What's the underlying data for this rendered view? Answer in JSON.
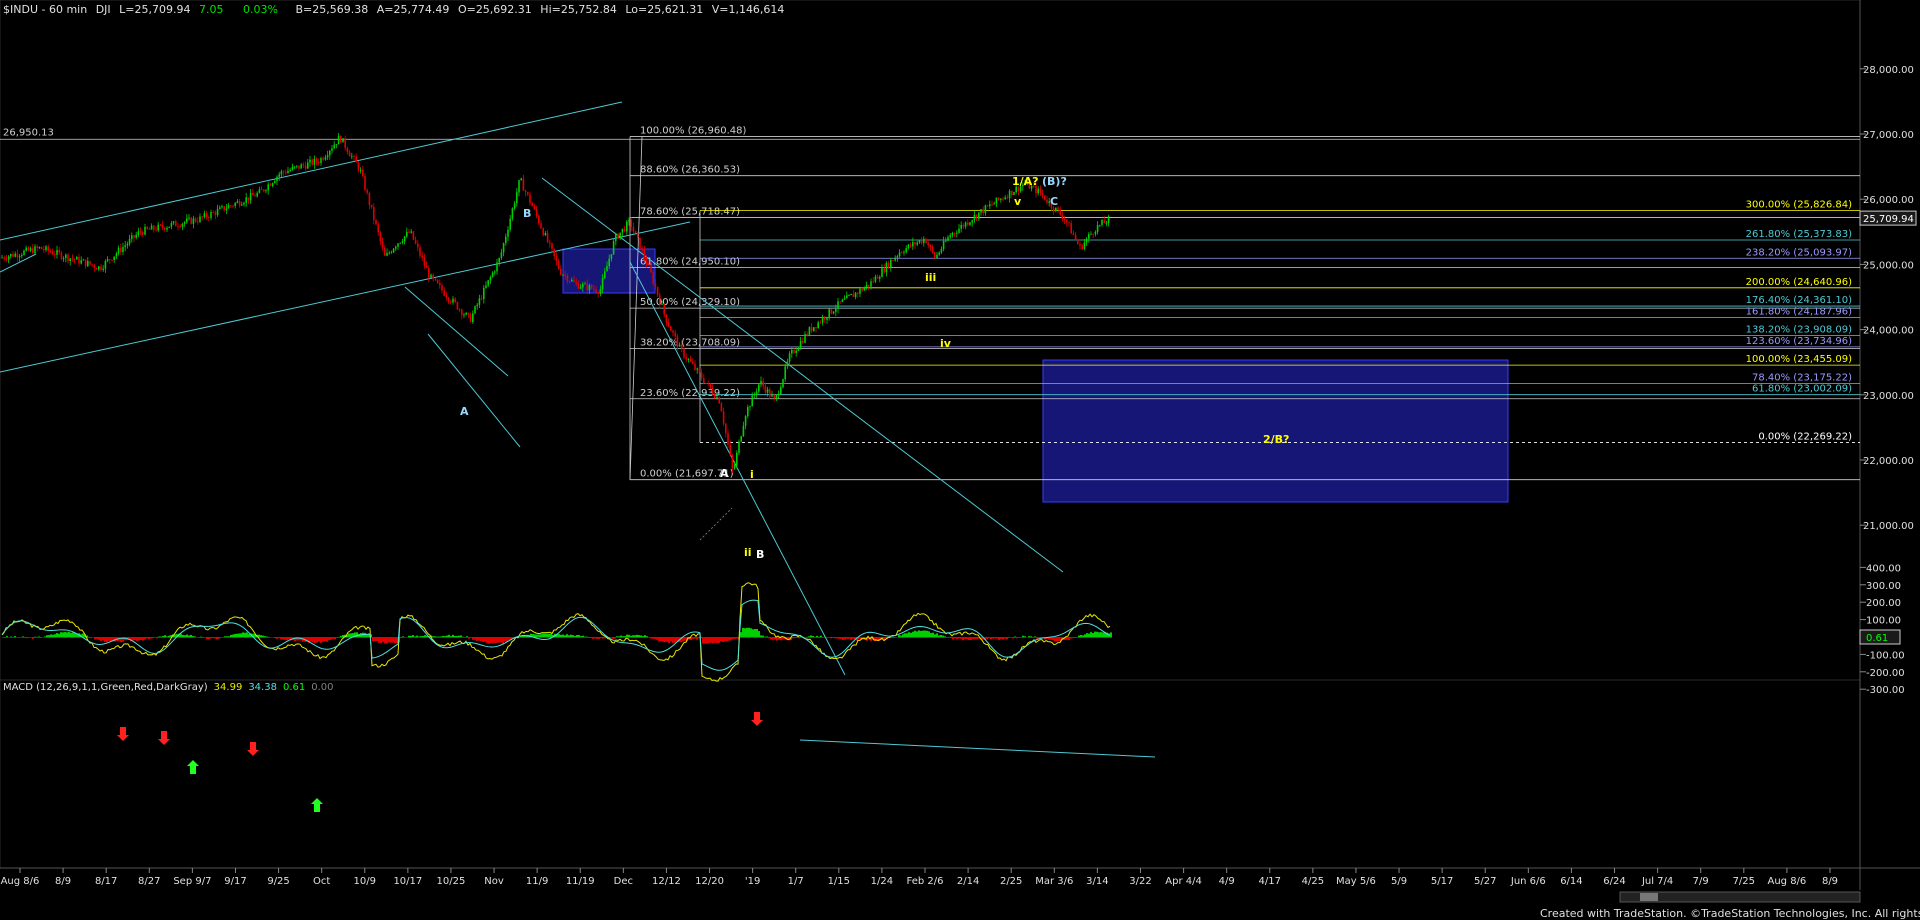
{
  "header": {
    "symbol": "$INDU - 60 min",
    "exchange": "DJI",
    "last": "L=25,709.94",
    "change": "7.05",
    "pct": "0.03%",
    "bid": "B=25,569.38",
    "ask": "A=25,774.49",
    "open": "O=25,692.31",
    "high": "Hi=25,752.84",
    "low": "Lo=25,621.31",
    "volume": "V=1,146,614"
  },
  "price_axis": {
    "ticks": [
      "28,000.00",
      "27,000.00",
      "26,000.00",
      "25,000.00",
      "24,000.00",
      "23,000.00",
      "22,000.00",
      "21,000.00"
    ],
    "ymin": 20500,
    "ymax": 28600,
    "last_price_label": "25,709.94"
  },
  "macd": {
    "title": "MACD (12,26,9,1,1,Green,Red,DarkGray)",
    "values": [
      "34.99",
      "34.38",
      "0.61",
      "0.00"
    ],
    "value_colors": [
      "#e8e800",
      "#4ee0e0",
      "#00ff00",
      "#808080"
    ],
    "ticks": [
      "400.00",
      "300.00",
      "200.00",
      "100.00",
      "-100.00",
      "-200.00",
      "-300.00"
    ],
    "last_label": "0.61",
    "ymin": -380,
    "ymax": 430
  },
  "x_axis": {
    "labels": [
      "Aug 8/6",
      "8/9",
      "8/17",
      "8/27",
      "Sep 9/7",
      "9/17",
      "9/25",
      "Oct",
      "10/9",
      "10/17",
      "10/25",
      "Nov",
      "11/9",
      "11/19",
      "Dec",
      "12/12",
      "12/20",
      "'19",
      "1/7",
      "1/15",
      "1/24",
      "Feb 2/6",
      "2/14",
      "2/25",
      "Mar 3/6",
      "3/14",
      "3/22",
      "Apr 4/4",
      "4/9",
      "4/17",
      "4/25",
      "May 5/6",
      "5/9",
      "5/17",
      "5/27",
      "Jun 6/6",
      "6/14",
      "6/24",
      "Jul 7/4",
      "7/9",
      "7/25",
      "Aug 8/6",
      "8/9"
    ]
  },
  "fib_left": [
    {
      "label": "100.00% (26,960.48)",
      "price": 26960.48
    },
    {
      "label": "88.60% (26,360.53)",
      "price": 26360.53
    },
    {
      "label": "78.60% (25,718.47)",
      "price": 25718.47
    },
    {
      "label": "61.80% (24,950.10)",
      "price": 24950.1
    },
    {
      "label": "50.00% (24,329.10)",
      "price": 24329.1
    },
    {
      "label": "38.20% (23,708.09)",
      "price": 23708.09
    },
    {
      "label": "23.60% (22,939.22)",
      "price": 22939.22
    },
    {
      "label": "0.00% (21,697.71)",
      "price": 21697.71
    }
  ],
  "fib_right": [
    {
      "label": "300.00% (25,826.84)",
      "price": 25826.84,
      "color": "#ffff00"
    },
    {
      "label": "261.80% (25,373.83)",
      "price": 25373.83,
      "color": "#4ec9d4"
    },
    {
      "label": "238.20% (25,093.97)",
      "price": 25093.97,
      "color": "#9a9aff"
    },
    {
      "label": "200.00% (24,640.96)",
      "price": 24640.96,
      "color": "#ffff00"
    },
    {
      "label": "176.40% (24,361.10)",
      "price": 24361.1,
      "color": "#4ec9d4"
    },
    {
      "label": "161.80% (24,187.96)",
      "price": 24187.96,
      "color": "#9a9aff"
    },
    {
      "label": "138.20% (23,908.09)",
      "price": 23908.09,
      "color": "#4ec9d4"
    },
    {
      "label": "123.60% (23,734.96)",
      "price": 23734.96,
      "color": "#9a9aff"
    },
    {
      "label": "100.00% (23,455.09)",
      "price": 23455.09,
      "color": "#ffff00"
    },
    {
      "label": "78.40% (23,175.22)",
      "price": 23175.22,
      "color": "#9a9aff"
    },
    {
      "label": "61.80% (23,002.09)",
      "price": 23002.09,
      "color": "#4ec9d4"
    },
    {
      "label": "0.00% (22,269.22)",
      "price": 22269.22,
      "color": "#ffffff"
    }
  ],
  "horizontal_level": {
    "label": "26,950.13",
    "price": 26950.13
  },
  "annotations": {
    "wave_1a": "1/A?",
    "wave_b_paren": "(B)?",
    "wave_v": "v",
    "wave_c": "C",
    "wave_iii": "iii",
    "wave_iv": "iv",
    "wave_2b": "2/B?",
    "wave_a_upper": "B",
    "wave_a_low": "A",
    "wave_i": "i",
    "wave_a_dec": "A",
    "wave_ii": "ii",
    "wave_b_dec": "B"
  },
  "footer": "Created with TradeStation. ©TradeStation Technologies, Inc. All rights reserved.",
  "colors": {
    "background": "#000000",
    "candle_up": "#00d000",
    "candle_down": "#e00000",
    "channel": "#4ec9d4",
    "fib_white": "#cfcfcf",
    "target_box": "#1a1a8c",
    "wave_yellow": "#ffff00",
    "wave_cyan": "#7fd7ff"
  }
}
